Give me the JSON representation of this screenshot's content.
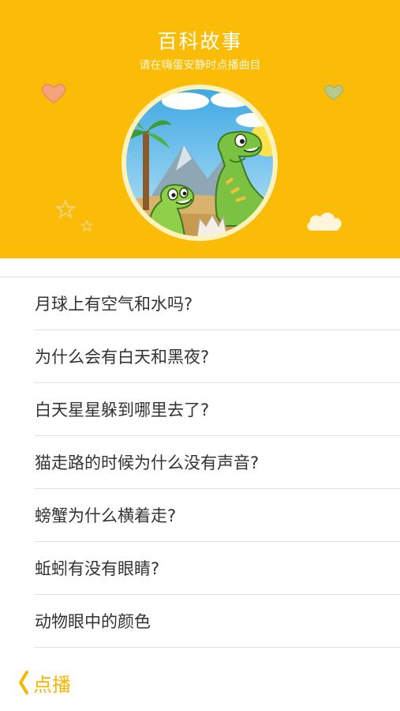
{
  "header": {
    "title": "百科故事",
    "subtitle": "请在嗨蛋安静时点播曲目",
    "background_color": "#fbbc07",
    "cover_image": "dinosaur-cartoon-illustration"
  },
  "list": {
    "items": [
      {
        "label": "月球上有空气和水吗?"
      },
      {
        "label": "为什么会有白天和黑夜?"
      },
      {
        "label": "白天星星躲到哪里去了?"
      },
      {
        "label": "猫走路的时候为什么没有声音?"
      },
      {
        "label": "螃蟹为什么横着走?"
      },
      {
        "label": "蚯蚓有没有眼睛?"
      },
      {
        "label": "动物眼中的颜色"
      }
    ]
  },
  "footer": {
    "back_label": "点播",
    "back_icon": "chevron-left-icon",
    "accent_color": "#f7b500"
  }
}
